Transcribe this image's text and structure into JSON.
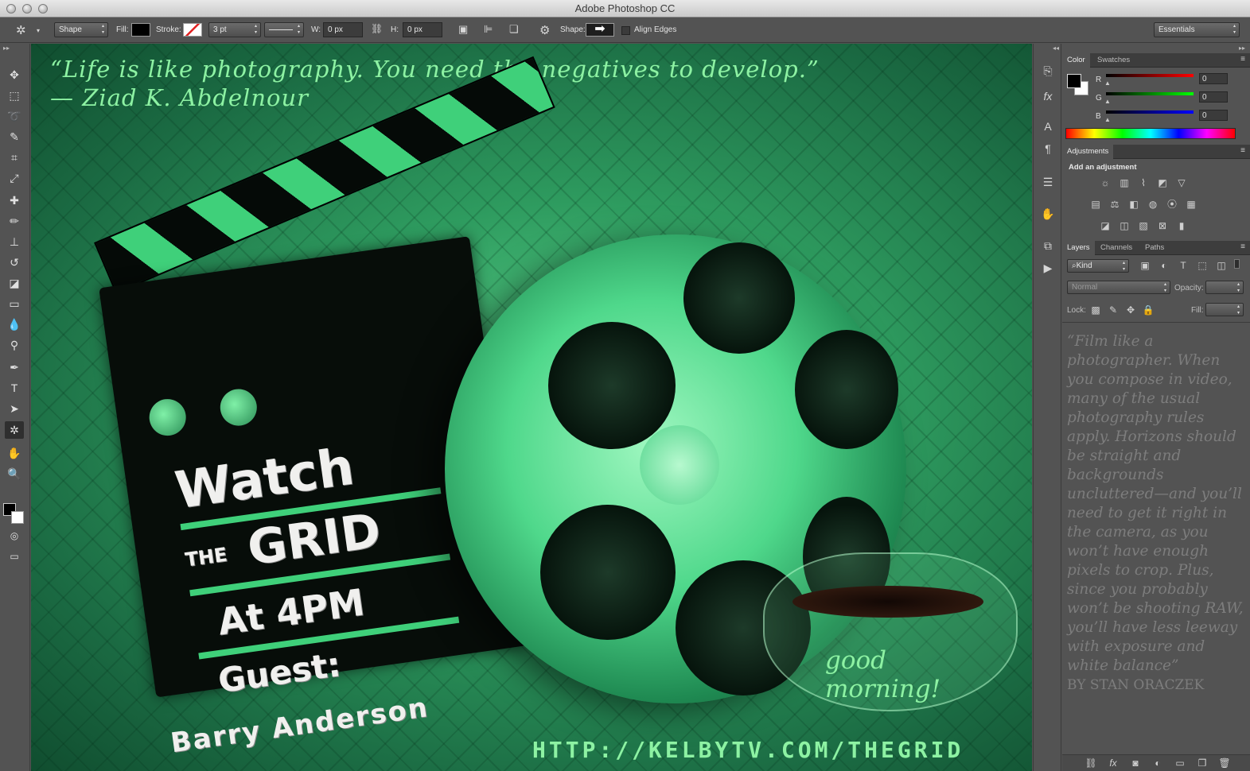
{
  "app": {
    "title": "Adobe Photoshop CC"
  },
  "options_bar": {
    "mode_select": "Shape",
    "fill_label": "Fill:",
    "stroke_label": "Stroke:",
    "stroke_width": "3 pt",
    "w_label": "W:",
    "w_value": "0 px",
    "h_label": "H:",
    "h_value": "0 px",
    "shape_label": "Shape:",
    "align_edges_label": "Align Edges",
    "workspace": "Essentials"
  },
  "tools": [
    "move-tool",
    "marquee-tool",
    "lasso-tool",
    "quick-select-tool",
    "crop-tool",
    "eyedropper-tool",
    "healing-brush-tool",
    "brush-tool",
    "clone-stamp-tool",
    "history-brush-tool",
    "eraser-tool",
    "gradient-tool",
    "blur-tool",
    "dodge-tool",
    "pen-tool",
    "type-tool",
    "path-select-tool",
    "custom-shape-tool",
    "hand-tool",
    "zoom-tool"
  ],
  "canvas": {
    "quote_line1": "“Life is like photography. You need the negatives to develop.”",
    "quote_line2": "— Ziad K. Abdelnour",
    "slate_watch": "Watch",
    "slate_the": "THE",
    "slate_grid": "GRID",
    "slate_time": "At 4PM",
    "slate_guest": "Guest:",
    "slate_name": "Barry Anderson",
    "good": "good",
    "morning": "morning!",
    "url": "HTTP://KELBYTV.COM/THEGRID"
  },
  "color_panel": {
    "tabs": [
      "Color",
      "Swatches"
    ],
    "channels": [
      {
        "label": "R",
        "value": "0",
        "color": "#d9322e"
      },
      {
        "label": "G",
        "value": "0",
        "color": "#3fbf3f"
      },
      {
        "label": "B",
        "value": "0",
        "color": "#2f56d6"
      }
    ]
  },
  "adjustments_panel": {
    "tab": "Adjustments",
    "heading": "Add an adjustment"
  },
  "layers_panel": {
    "tabs": [
      "Layers",
      "Channels",
      "Paths"
    ],
    "filter": "Kind",
    "blend_mode": "Normal",
    "opacity_label": "Opacity:",
    "lock_label": "Lock:",
    "fill_label": "Fill:",
    "overlay_quote": "“Film like a photographer. When you compose in video, many of the usual photography rules apply. Horizons should be straight and backgrounds uncluttered—and you’ll need to get it right in the camera, as you won’t have enough pixels to crop. Plus, since you probably won’t be shooting RAW, you’ll have less leeway with exposure and white balance”",
    "overlay_author": "BY STAN ORACZEK"
  },
  "colors": {
    "canvas_accent": "#8df2a3",
    "panel_bg": "#535353"
  }
}
